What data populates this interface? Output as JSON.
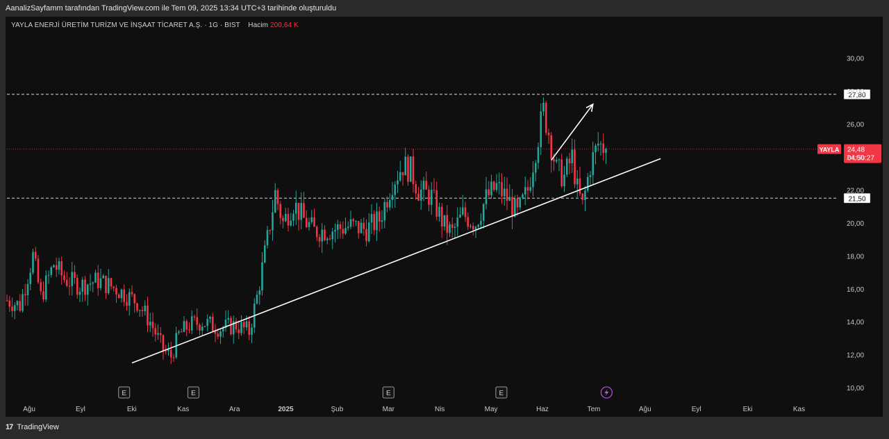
{
  "caption": "AanalizSayfamm tarafından TradingView.com ile Tem 09, 2025 13:34 UTC+3 tarihinde oluşturuldu",
  "header": {
    "symbol_line": "YAYLA ENERJİ ÜRETİM TURİZM VE İNŞAAT TİCARET A.Ş. · 1G · BIST",
    "volume_label": "Hacim",
    "volume_value": "200,64 K"
  },
  "footer": {
    "brand": "TradingView",
    "logo_glyph": "17"
  },
  "colors": {
    "up": "#26a69a",
    "down": "#f23645",
    "background": "#0f0f0f",
    "line": "#ffffff"
  },
  "chart_data": {
    "type": "candlestick",
    "interval": "1G",
    "y_range": [
      9.5,
      31.5
    ],
    "y_ticks": [
      "10,00",
      "12,00",
      "14,00",
      "16,00",
      "18,00",
      "20,00",
      "22,00",
      "24,00",
      "26,00",
      "28,00",
      "30,00"
    ],
    "x_labels": [
      "Ağu",
      "Eyl",
      "Eki",
      "Kas",
      "Ara",
      "2025",
      "Şub",
      "Mar",
      "Nis",
      "May",
      "Haz",
      "Tem",
      "Ağu",
      "Eyl",
      "Eki",
      "Kas"
    ],
    "price_path": [
      [
        0,
        15.3
      ],
      [
        5,
        15.0
      ],
      [
        10,
        18.0
      ],
      [
        13,
        15.5
      ],
      [
        18,
        17.5
      ],
      [
        22,
        16.6
      ],
      [
        28,
        16.2
      ],
      [
        35,
        16.5
      ],
      [
        42,
        16.0
      ],
      [
        50,
        15.2
      ],
      [
        55,
        14.0
      ],
      [
        60,
        12.3
      ],
      [
        63,
        11.9
      ],
      [
        66,
        13.2
      ],
      [
        70,
        13.8
      ],
      [
        75,
        14.0
      ],
      [
        82,
        13.6
      ],
      [
        88,
        13.8
      ],
      [
        93,
        13.4
      ],
      [
        96,
        15.5
      ],
      [
        100,
        19.0
      ],
      [
        103,
        21.8
      ],
      [
        106,
        20.0
      ],
      [
        110,
        21.2
      ],
      [
        114,
        20.2
      ],
      [
        118,
        19.5
      ],
      [
        125,
        19.6
      ],
      [
        132,
        19.8
      ],
      [
        138,
        19.6
      ],
      [
        143,
        20.2
      ],
      [
        148,
        22.5
      ],
      [
        152,
        23.5
      ],
      [
        155,
        23.2
      ],
      [
        158,
        22.0
      ],
      [
        163,
        21.6
      ],
      [
        168,
        19.8
      ],
      [
        171,
        19.4
      ],
      [
        175,
        20.5
      ],
      [
        180,
        20.0
      ],
      [
        184,
        21.5
      ],
      [
        188,
        22.2
      ],
      [
        192,
        21.5
      ],
      [
        196,
        20.5
      ],
      [
        200,
        22.0
      ],
      [
        203,
        24.5
      ],
      [
        206,
        26.8
      ],
      [
        208,
        25.5
      ],
      [
        211,
        23.2
      ],
      [
        214,
        22.8
      ],
      [
        217,
        24.0
      ],
      [
        219,
        22.0
      ],
      [
        221,
        21.0
      ],
      [
        224,
        23.5
      ],
      [
        227,
        24.8
      ],
      [
        230,
        24.5
      ]
    ],
    "volume": {
      "label": "Hacim",
      "value": "200,64 K"
    },
    "last_price": {
      "symbol": "YAYLA",
      "value": "24,48",
      "countdown": "04:50:27"
    },
    "horizontal_levels": [
      {
        "value": 27.8,
        "label": "27,80",
        "style": "dashed"
      },
      {
        "value": 21.5,
        "label": "21,50",
        "style": "dashed"
      }
    ],
    "trendline": {
      "from": {
        "bar": 48,
        "price": 11.5
      },
      "to": {
        "bar": 251,
        "price": 23.9
      }
    },
    "arrow": {
      "from": {
        "bar": 209,
        "price": 23.8
      },
      "to": {
        "bar": 225,
        "price": 27.2
      }
    },
    "event_markers": [
      {
        "month_index": 1.85,
        "icon": "E"
      },
      {
        "month_index": 3.2,
        "icon": "E"
      },
      {
        "month_index": 7.0,
        "icon": "E"
      },
      {
        "month_index": 9.2,
        "icon": "E"
      },
      {
        "month_index": 11.25,
        "icon": "lightning"
      }
    ]
  }
}
